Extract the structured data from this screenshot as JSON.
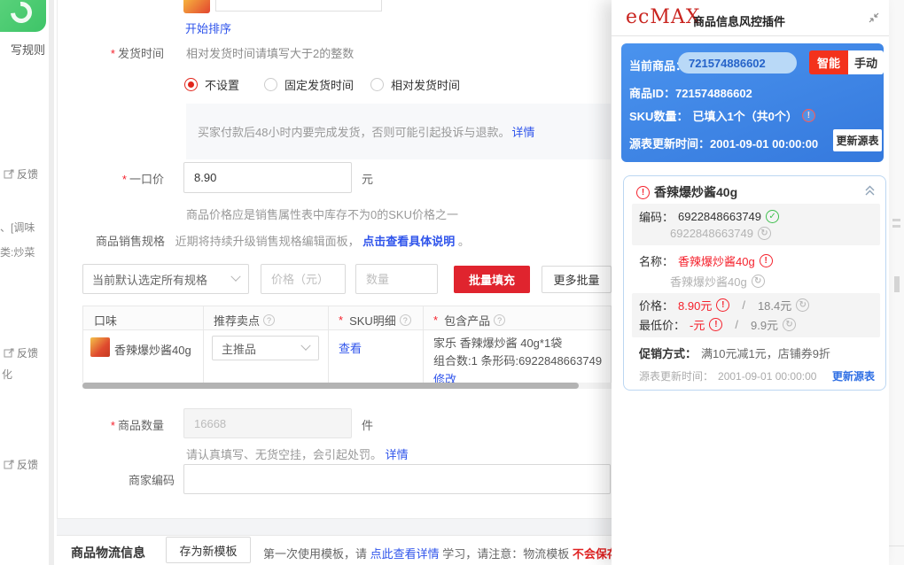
{
  "colors": {
    "panelBlue": "#3d87e8",
    "alertRed": "#f5222d",
    "buttonRed": "#e0242e",
    "linkBlue": "#2f54eb",
    "successGreen": "#3fbf4e"
  },
  "leftRail": {
    "ruleText": "写规则",
    "feedback1": "反馈",
    "fragSeasoning": "、[调味",
    "fragCategory": "类:炒菜",
    "feedback2": "反馈",
    "fragHua": "化",
    "feedback3": "反馈"
  },
  "main": {
    "sortLink": "开始排序",
    "shipping": {
      "label": "发货时间",
      "hint": "相对发货时间请填写大于2的整数",
      "options": [
        {
          "label": "不设置"
        },
        {
          "label": "固定发货时间"
        },
        {
          "label": "相对发货时间"
        }
      ],
      "notice": "买家付款后48小时内要完成发货，否则可能引起投诉与退款。",
      "noticeLink": "详情"
    },
    "price": {
      "label": "一口价",
      "value": "8.90",
      "unit": "元",
      "hint": "商品价格应是销售属性表中库存不为0的SKU价格之一"
    },
    "spec": {
      "label": "商品销售规格",
      "desc": "近期将持续升级销售规格编辑面板，",
      "link": "点击查看具体说明",
      "suffix": "。"
    },
    "batch": {
      "selectValue": "当前默认选定所有规格",
      "pricePlaceholder": "价格（元）",
      "qtyPlaceholder": "数量",
      "fillButton": "批量填充",
      "moreButton": "更多批量"
    },
    "table": {
      "headers": [
        "口味",
        "推荐卖点",
        "SKU明细",
        "包含产品"
      ],
      "row": {
        "name": "香辣爆炒酱40g",
        "sellingPoint": "主推品",
        "skuLink": "查看",
        "product1": "家乐 香辣爆炒酱 40g*1袋",
        "product2": "组合数:1 条形码:6922848663749",
        "editLink": "修改"
      }
    },
    "quantity": {
      "label": "商品数量",
      "value": "16668",
      "unit": "件",
      "hint": "请认真填写、无货空挂，会引起处罚。",
      "hintLink": "详情"
    },
    "merchantCode": {
      "label": "商家编码"
    }
  },
  "logistics": {
    "title": "商品物流信息",
    "saveButton": "存为新模板",
    "text1": "第一次使用模板，请 ",
    "link": "点此查看详情",
    "text2": " 学习，请注意：物流模板",
    "warning": "不会保存电子交易凭"
  },
  "plugin": {
    "logo": "ecMAX",
    "title": "商品信息风控插件",
    "current": {
      "label": "当前商品：",
      "value": "721574886602",
      "smartButton": "智能",
      "manualButton": "手动",
      "idLabel": "商品ID：",
      "idValue": "721574886602",
      "skuLabel": "SKU数量：",
      "skuValue": "已填入1个（共0个）",
      "updateLabel": "源表更新时间：",
      "updateValue": "2001-09-01 00:00:00",
      "updateButton": "更新源表"
    },
    "product": {
      "title": "香辣爆炒酱40g",
      "codeLabel": "编码：",
      "codeValue": "6922848663749",
      "codeSource": "6922848663749",
      "nameLabel": "名称：",
      "nameValue": "香辣爆炒酱40g",
      "nameSource": "香辣爆炒酱40g",
      "priceLabel": "价格：",
      "priceValue": "8.90元",
      "priceSource": "18.4元",
      "minLabel": "最低价：",
      "minValue": "-元",
      "minSource": "9.9元",
      "slash": "/",
      "promoLabel": "促销方式：",
      "promoValue": "满10元减1元，店铺券9折",
      "updateLabel": "源表更新时间：",
      "updateValue": "2001-09-01 00:00:00",
      "updateLink": "更新源表"
    }
  }
}
